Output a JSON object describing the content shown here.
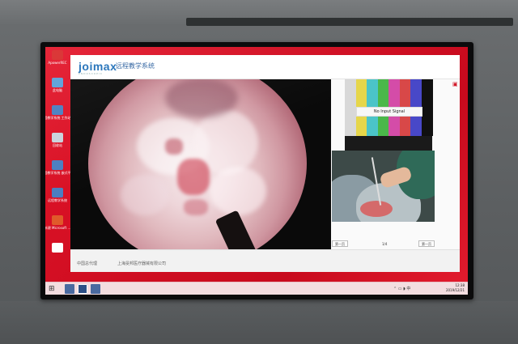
{
  "desktop": {
    "icons": [
      {
        "label": "ApowerREC",
        "color": "#d82a2a"
      },
      {
        "label": "此电脑",
        "color": "#5aa0d8"
      },
      {
        "label": "远程教学系统 工作站端",
        "color": "#4a7ec0"
      },
      {
        "label": "回收站",
        "color": "#c9d3dc"
      },
      {
        "label": "远程教学系统 嵌式平端",
        "color": "#4a7ec0"
      },
      {
        "label": "远程教学系统",
        "color": "#4a7ec0"
      },
      {
        "label": "新建 Microsoft ...",
        "color": "#e05a2a"
      },
      {
        "label": "",
        "color": "#ffffff"
      }
    ]
  },
  "app": {
    "logo": "joimax",
    "logo_sub": "ENDOSCOPIC",
    "title": "远程教学系统",
    "no_signal": "No Input Signal",
    "color_bars": [
      "#d8d8d8",
      "#e6d64a",
      "#4bc4c8",
      "#4ab84a",
      "#d44ca8",
      "#d84848",
      "#4848c8",
      "#101010"
    ],
    "pager": {
      "prev": "第一页",
      "middle": "1/4",
      "next": "第一页"
    },
    "footer": {
      "left": "中国总代理",
      "right": "上海旻邦医疗器械有限公司"
    }
  },
  "taskbar": {
    "start_icon": "windows-icon",
    "clock_time": "12:38",
    "clock_date": "2019/12/21"
  }
}
